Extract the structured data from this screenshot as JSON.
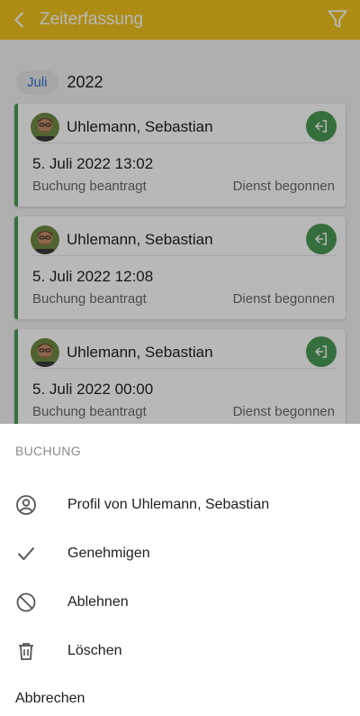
{
  "appbar": {
    "title": "Zeiterfassung"
  },
  "filter": {
    "month": "Juli",
    "year": "2022"
  },
  "entries": [
    {
      "name": "Uhlemann, Sebastian",
      "datetime": "5. Juli 2022 13:02",
      "status": "Buchung beantragt",
      "event": "Dienst begonnen"
    },
    {
      "name": "Uhlemann, Sebastian",
      "datetime": "5. Juli 2022 12:08",
      "status": "Buchung beantragt",
      "event": "Dienst begonnen"
    },
    {
      "name": "Uhlemann, Sebastian",
      "datetime": "5. Juli 2022 00:00",
      "status": "Buchung beantragt",
      "event": "Dienst begonnen"
    }
  ],
  "sheet": {
    "title": "BUCHUNG",
    "items": [
      {
        "label": "Profil von Uhlemann, Sebastian",
        "icon": "account-circle-icon"
      },
      {
        "label": "Genehmigen",
        "icon": "check-icon"
      },
      {
        "label": "Ablehnen",
        "icon": "block-icon"
      },
      {
        "label": "Löschen",
        "icon": "trash-icon"
      }
    ],
    "cancel": "Abbrechen"
  },
  "colors": {
    "appbar": "#f0c21e",
    "accent_green": "#4c9a57",
    "chip_text": "#2e6fd6"
  }
}
